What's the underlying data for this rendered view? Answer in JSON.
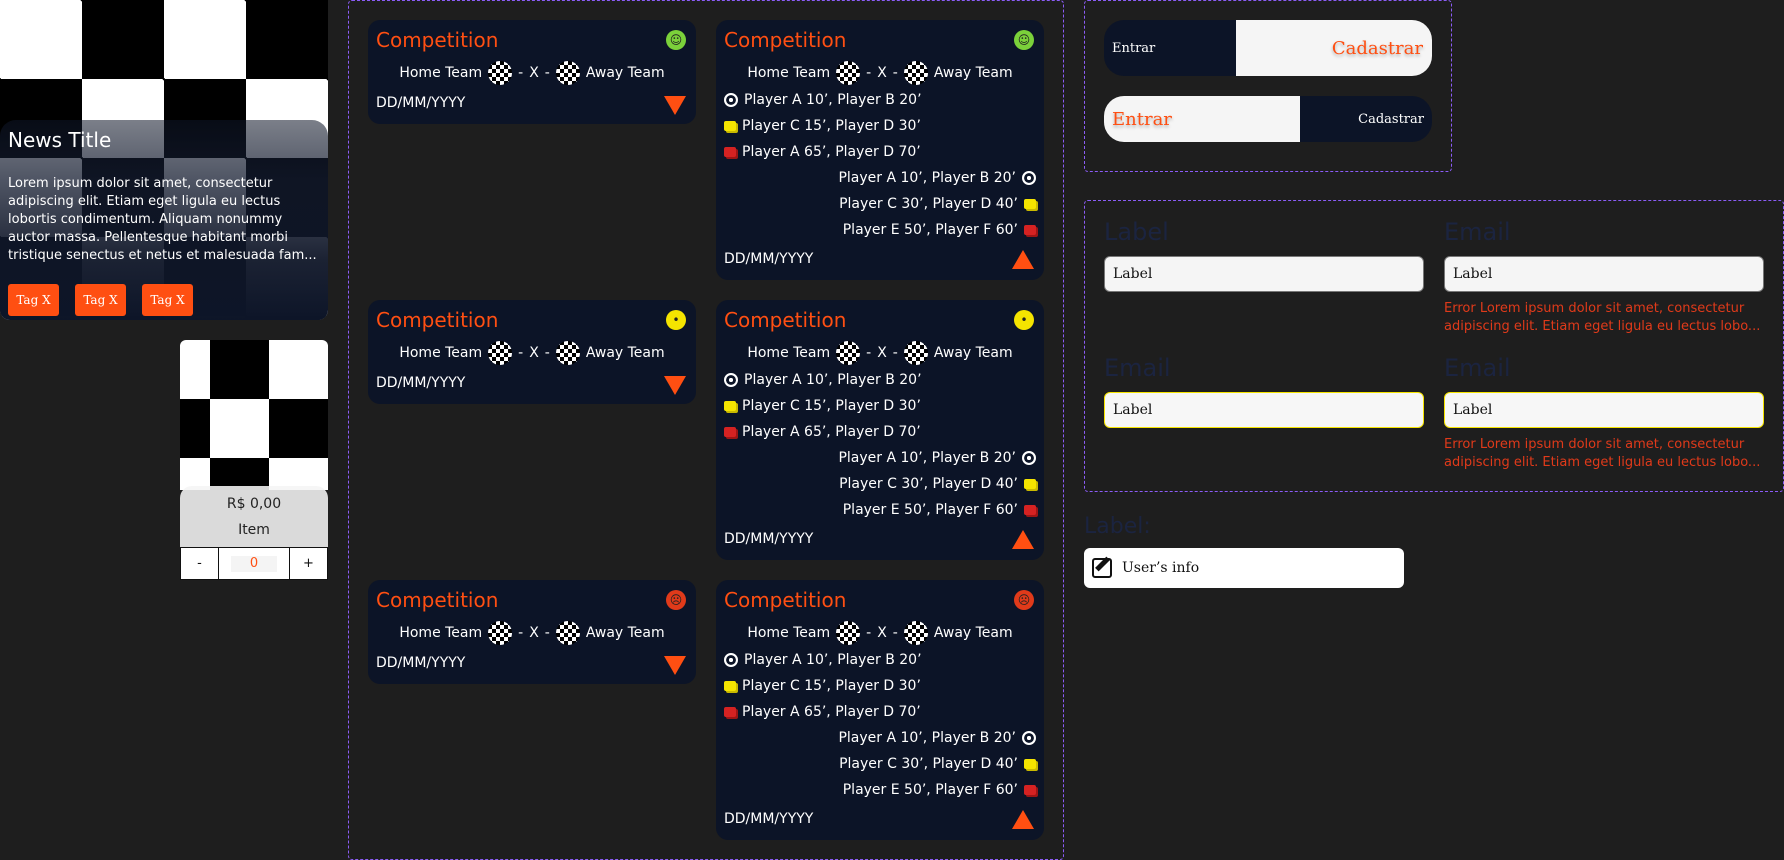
{
  "news": {
    "title": "News Title",
    "body": "Lorem ipsum dolor sit amet, consectetur adipiscing elit. Etiam eget ligula eu lectus lobortis condimentum. Aliquam nonummy auctor massa. Pellentesque habitant morbi tristique senectus et netus et malesuada fam...",
    "tags": [
      "Tag X",
      "Tag X",
      "Tag X"
    ]
  },
  "product": {
    "price": "R$ 0,00",
    "name": "Item",
    "minus": "-",
    "plus": "+",
    "quantity": "0"
  },
  "match": {
    "competition": "Competition",
    "home": "Home Team",
    "away": "Away Team",
    "sep": "-",
    "versus": "X",
    "date": "DD/MM/YYYY",
    "home_events": [
      "Player A 10’, Player B 20’",
      "Player C 15’, Player D 30’",
      "Player A 65’, Player D 70’"
    ],
    "away_events": [
      "Player A 10’, Player B 20’",
      "Player C 30’, Player D 40’",
      "Player E 50’, Player F 60’"
    ],
    "moods": {
      "happy": "☺",
      "neutral": "•",
      "sad": "☹"
    },
    "mood_colors": {
      "happy": "#7bd13a",
      "neutral": "#f5e400",
      "sad": "#e03a1a"
    }
  },
  "auth": {
    "login": "Entrar",
    "register": "Cadastrar"
  },
  "form": {
    "fields": [
      {
        "label": "Label",
        "value": "Label"
      },
      {
        "label": "Email",
        "value": "Label",
        "error": "Error Lorem ipsum dolor sit amet, consectetur adipiscing elit. Etiam eget ligula eu lectus lobo..."
      },
      {
        "label": "Email",
        "value": "Label"
      },
      {
        "label": "Email",
        "value": "Label",
        "error": "Error Lorem ipsum dolor sit amet, consectetur adipiscing elit. Etiam eget ligula eu lectus lobo..."
      }
    ]
  },
  "user_info": {
    "label": "Label:",
    "value": "User’s info"
  },
  "colors": {
    "accent": "#ff4f12",
    "card_bg": "#0c1427",
    "page_bg": "#1e1e1e",
    "dashed": "#8b5cf6"
  }
}
